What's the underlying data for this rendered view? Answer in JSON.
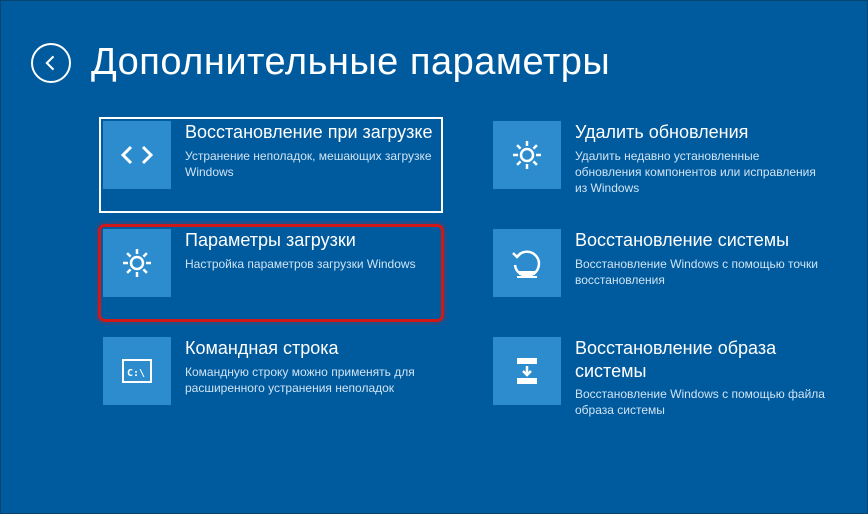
{
  "header": {
    "title": "Дополнительные параметры"
  },
  "left": [
    {
      "title": "Восстановление при загрузке",
      "desc": "Устранение неполадок, мешающих загрузке Windows",
      "icon": "code-icon",
      "state": "focused"
    },
    {
      "title": "Параметры загрузки",
      "desc": "Настройка параметров загрузки Windows",
      "icon": "gear-icon",
      "state": "highlighted"
    },
    {
      "title": "Командная строка",
      "desc": "Командную строку можно применять для расширенного устранения неполадок",
      "icon": "terminal-icon",
      "state": ""
    }
  ],
  "right": [
    {
      "title": "Удалить обновления",
      "desc": "Удалить недавно установленные обновления компонентов или исправления из Windows",
      "icon": "gear-icon",
      "state": ""
    },
    {
      "title": "Восстановление системы",
      "desc": "Восстановление Windows с помощью точки восстановления",
      "icon": "restore-icon",
      "state": ""
    },
    {
      "title": "Восстановление образа системы",
      "desc": "Восстановление Windows с помощью файла образа системы",
      "icon": "image-restore-icon",
      "state": ""
    }
  ]
}
